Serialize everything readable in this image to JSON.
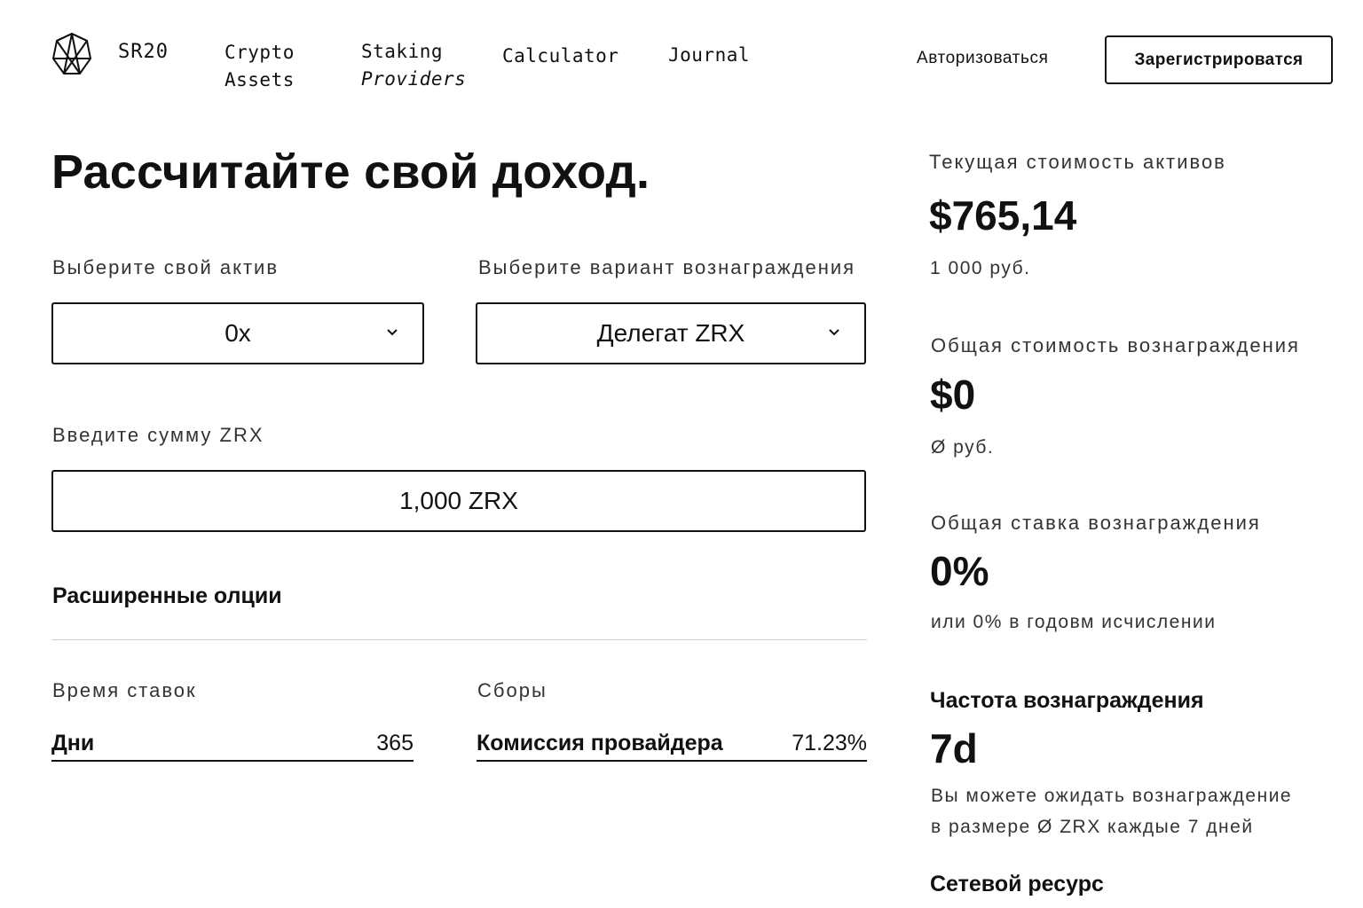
{
  "header": {
    "brand": "SR20",
    "nav": [
      {
        "line1": "Crypto",
        "line2": "Assets"
      },
      {
        "line1": "Staking",
        "line2": "Providers"
      },
      {
        "line1": "Calculator"
      },
      {
        "line1": "Journal"
      }
    ],
    "login": "Авторизоваться",
    "signup": "Зарегистрироватся"
  },
  "calculator": {
    "title": "Рассчитайте свой доход.",
    "asset_label": "Выберите свой актив",
    "asset_value": "0x",
    "reward_label": "Выберите вариант вознаграждения",
    "reward_value": "Делегат ZRX",
    "amount_label": "Введите сумму ZRX",
    "amount_value": "1,000 ZRX",
    "advanced": "Расширенные олции",
    "staking_time_label": "Время ставок",
    "days_key": "Дни",
    "days_value": "365",
    "fees_label": "Сборы",
    "commission_key": "Комиссия провайдера",
    "commission_value": "71.23%"
  },
  "summary": {
    "current_value_label": "Текущая стоимость активов",
    "current_value": "$765,14",
    "current_value_rub": "1 000 руб.",
    "total_reward_label": "Общая стоимость вознаграждения",
    "total_reward": "$0",
    "total_reward_rub": "Ø руб.",
    "reward_rate_label": "Общая ставка вознаграждения",
    "reward_rate": "0%",
    "reward_rate_annual": "или 0% в годовм исчислении",
    "frequency_label": "Частота вознаграждения",
    "frequency": "7d",
    "frequency_desc_1": "Вы можете ожидать вознаграждение",
    "frequency_desc_2": "в размере Ø ZRX каждые 7 дней",
    "network_label": "Сетевой ресурс"
  }
}
